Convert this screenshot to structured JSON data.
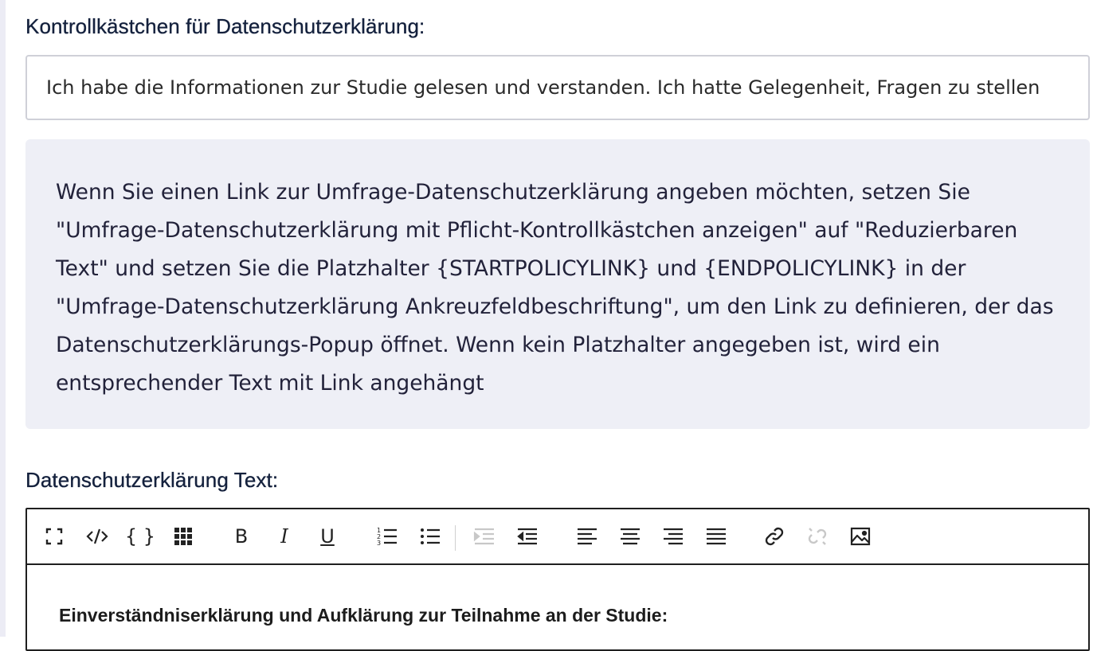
{
  "privacy_checkbox": {
    "label": "Kontrollkästchen für Datenschutzerklärung:",
    "value": "Ich habe die Informationen zur Studie gelesen und verstanden. Ich hatte Gelegenheit, Fragen zu stellen"
  },
  "info_box": {
    "text": "Wenn Sie einen Link zur Umfrage-Datenschutzerklärung angeben möchten, setzen Sie \"Umfrage-Datenschutzerklärung mit Pflicht-Kontrollkästchen anzeigen\" auf \"Reduzierbaren Text\" und setzen Sie die Platzhalter {STARTPOLICYLINK} und {ENDPOLICYLINK} in der \"Umfrage-Datenschutzerklärung Ankreuzfeldbeschriftung\", um den Link zu definieren, der das Datenschutzerklärungs-Popup öffnet. Wenn kein Platzhalter angegeben ist, wird ein entsprechender Text mit Link angehängt"
  },
  "privacy_text": {
    "label": "Datenschutzerklärung Text:"
  },
  "toolbar": {
    "bold_label": "B",
    "italic_label": "I",
    "underline_label": "U",
    "braces_label": "{ }",
    "icons": [
      "fullscreen-icon",
      "source-code-icon",
      "placeholder-icon",
      "grid-icon",
      "bold-icon",
      "italic-icon",
      "underline-icon",
      "ordered-list-icon",
      "unordered-list-icon",
      "outdent-icon",
      "indent-icon",
      "align-left-icon",
      "align-center-icon",
      "align-right-icon",
      "align-justify-icon",
      "link-icon",
      "unlink-icon",
      "image-icon"
    ]
  },
  "editor": {
    "content_heading": "Einverständniserklärung und Aufklärung zur Teilnahme an der Studie:"
  },
  "colors": {
    "info_background": "#eeeff6",
    "label_text": "#14213d",
    "disabled_icon": "#c8c8c8"
  }
}
